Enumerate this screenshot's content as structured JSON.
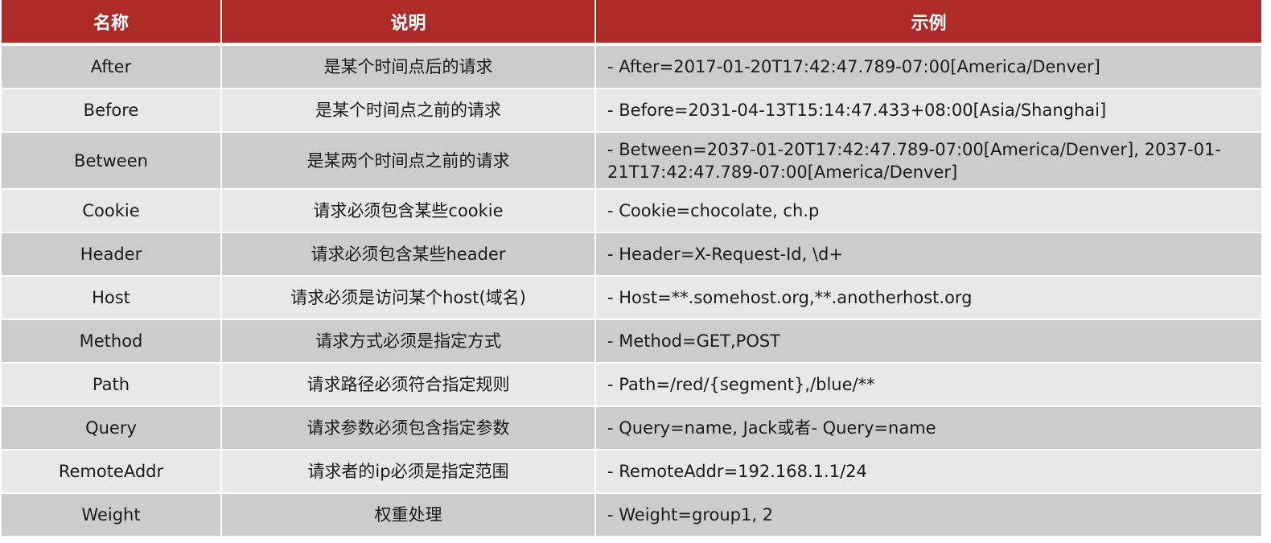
{
  "table": {
    "headers": [
      "名称",
      "说明",
      "示例"
    ],
    "rows": [
      {
        "name": "After",
        "desc": "是某个时间点后的请求",
        "example": "- After=2017-01-20T17:42:47.789-07:00[America/Denver]"
      },
      {
        "name": "Before",
        "desc": "是某个时间点之前的请求",
        "example": "- Before=2031-04-13T15:14:47.433+08:00[Asia/Shanghai]"
      },
      {
        "name": "Between",
        "desc": "是某两个时间点之前的请求",
        "example": "- Between=2037-01-20T17:42:47.789-07:00[America/Denver], 2037-01-21T17:42:47.789-07:00[America/Denver]"
      },
      {
        "name": "Cookie",
        "desc": "请求必须包含某些cookie",
        "example": "- Cookie=chocolate, ch.p"
      },
      {
        "name": "Header",
        "desc": "请求必须包含某些header",
        "example": "- Header=X-Request-Id, \\d+"
      },
      {
        "name": "Host",
        "desc": "请求必须是访问某个host(域名)",
        "example": "- Host=**.somehost.org,**.anotherhost.org"
      },
      {
        "name": "Method",
        "desc": "请求方式必须是指定方式",
        "example": "- Method=GET,POST"
      },
      {
        "name": "Path",
        "desc": "请求路径必须符合指定规则",
        "example": "- Path=/red/{segment},/blue/**"
      },
      {
        "name": "Query",
        "desc": "请求参数必须包含指定参数",
        "example": "- Query=name, Jack或者- Query=name"
      },
      {
        "name": "RemoteAddr",
        "desc": "请求者的ip必须是指定范围",
        "example": "- RemoteAddr=192.168.1.1/24"
      },
      {
        "name": "Weight",
        "desc": "权重处理",
        "example": "- Weight=group1, 2"
      }
    ]
  }
}
